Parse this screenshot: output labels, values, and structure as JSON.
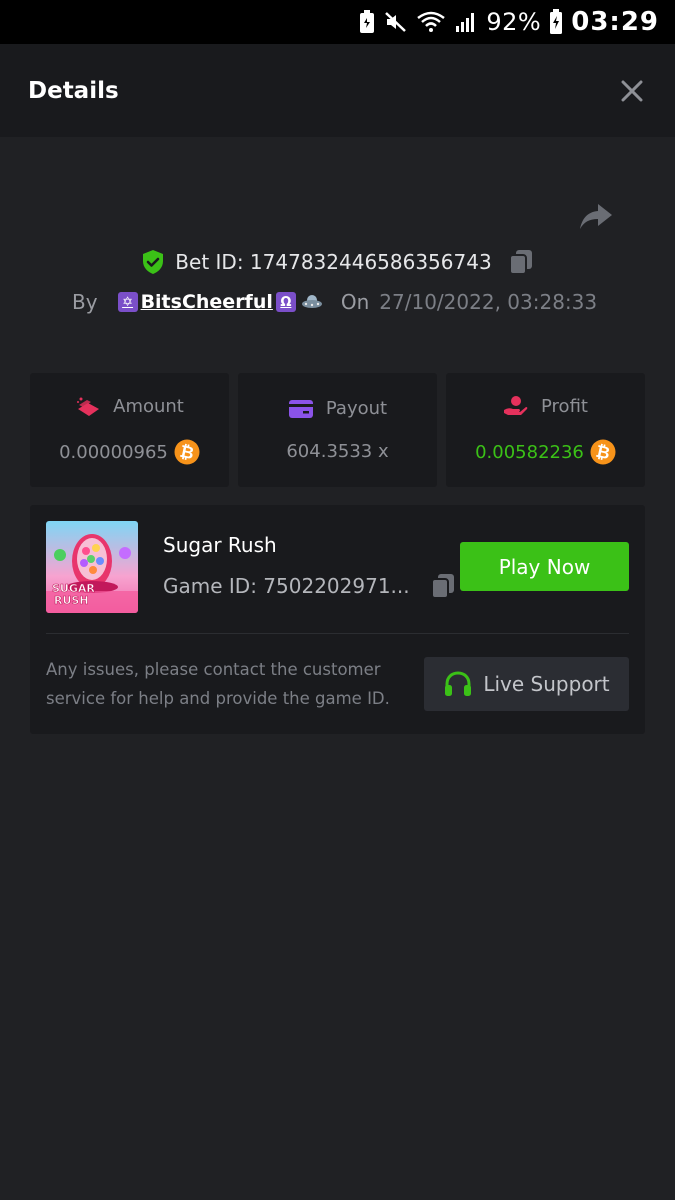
{
  "status_bar": {
    "battery_percent": "92%",
    "time": "03:29",
    "icons": [
      "battery-saver-icon",
      "mute-icon",
      "wifi-icon",
      "signal-icon",
      "battery-icon"
    ]
  },
  "header": {
    "title": "Details",
    "close_icon": "close-icon"
  },
  "bet": {
    "bet_id_label": "Bet ID: 1747832446586356743",
    "by_label": "By",
    "username": "BitsCheerful",
    "username_prefix_emoji": "✡",
    "username_suffix_emoji": "Ω",
    "on_label": "On",
    "date": "27/10/2022, 03:28:33"
  },
  "stats": [
    {
      "label": "Amount",
      "value": "0.00000965",
      "icon": "amount-icon",
      "currency_icon": "bitcoin-icon",
      "value_color": "#8e9096"
    },
    {
      "label": "Payout",
      "value": "604.3533 x",
      "icon": "payout-icon",
      "value_color": "#8e9096"
    },
    {
      "label": "Profit",
      "value": "0.00582236",
      "icon": "profit-icon",
      "currency_icon": "bitcoin-icon",
      "value_color": "#3bc117"
    }
  ],
  "game": {
    "name": "Sugar Rush",
    "game_id": "Game ID: 7502202971...",
    "play_label": "Play Now",
    "thumb_text_1": "SUGAR",
    "thumb_text_2": "RUSH",
    "issue_text": "Any issues, please contact the customer service for help and provide the game ID.",
    "support_label": "Live Support"
  },
  "colors": {
    "background": "#202124",
    "card": "#191a1d",
    "accent_green": "#3bc117",
    "bitcoin": "#f7931a"
  }
}
